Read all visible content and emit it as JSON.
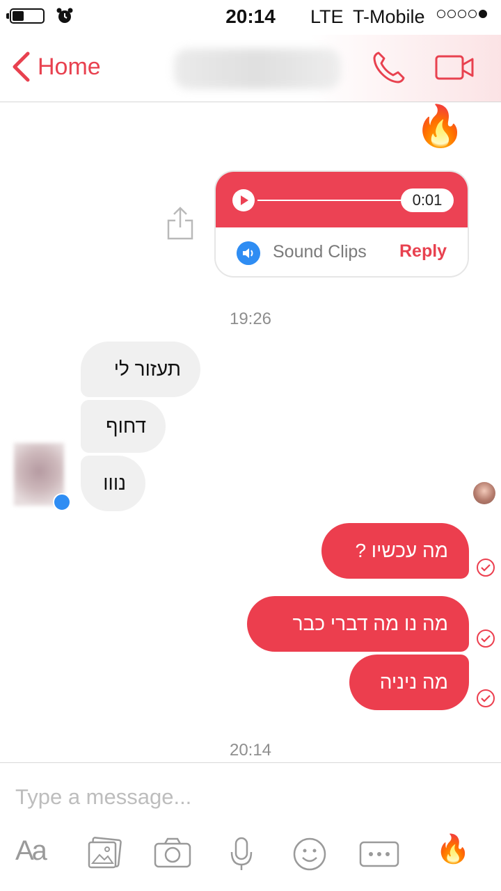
{
  "status_bar": {
    "time": "20:14",
    "network": "LTE",
    "carrier": "T-Mobile",
    "signal_dots_filled": 1,
    "signal_dots_total": 5
  },
  "header": {
    "back_label": "Home",
    "accent_color": "#e8414f"
  },
  "thread": {
    "top_emoji": "🔥",
    "audio_clip": {
      "duration": "0:01",
      "app_label": "Sound Clips",
      "reply_label": "Reply"
    },
    "timestamp_1": "19:26",
    "incoming": [
      {
        "text": "תעזור לי"
      },
      {
        "text": "דחוף"
      },
      {
        "text": "נווו"
      }
    ],
    "outgoing": [
      {
        "text": "מה עכשיו ?"
      },
      {
        "text": "מה נו מה דברי כבר"
      },
      {
        "text": "מה ניניה"
      }
    ],
    "timestamp_2": "20:14"
  },
  "composer": {
    "placeholder": "Type a message...",
    "text_tool_label": "Aa",
    "like_emoji": "🔥"
  },
  "icons": [
    "alarm-icon",
    "chevron-left-icon",
    "phone-icon",
    "video-camera-icon",
    "play-icon",
    "speaker-icon",
    "share-icon",
    "check-circle-icon",
    "gallery-icon",
    "camera-icon",
    "microphone-icon",
    "smiley-icon",
    "more-icon"
  ]
}
